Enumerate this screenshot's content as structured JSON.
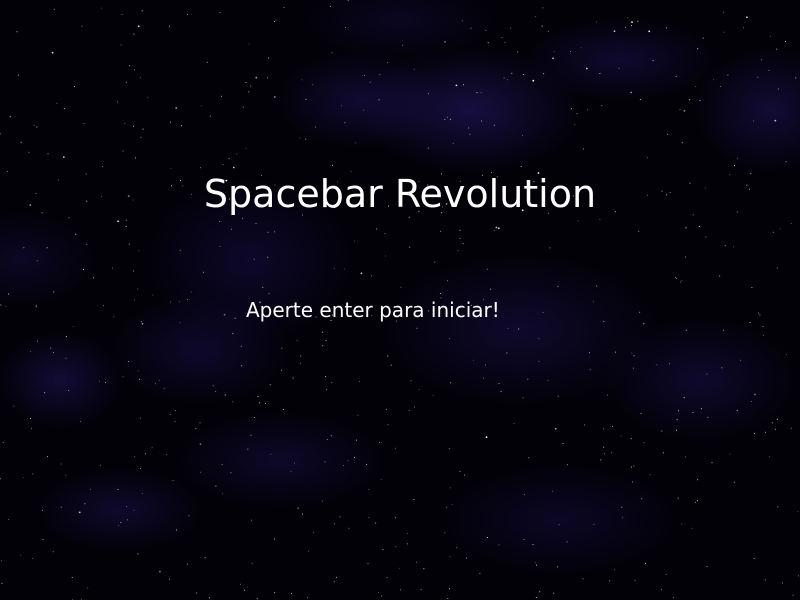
{
  "game": {
    "title": "Spacebar Revolution",
    "prompt": "Aperte enter para iniciar!"
  },
  "colors": {
    "background": "#020108",
    "nebula": "#281a6e",
    "text": "#ffffff",
    "star": "#ffffff"
  }
}
